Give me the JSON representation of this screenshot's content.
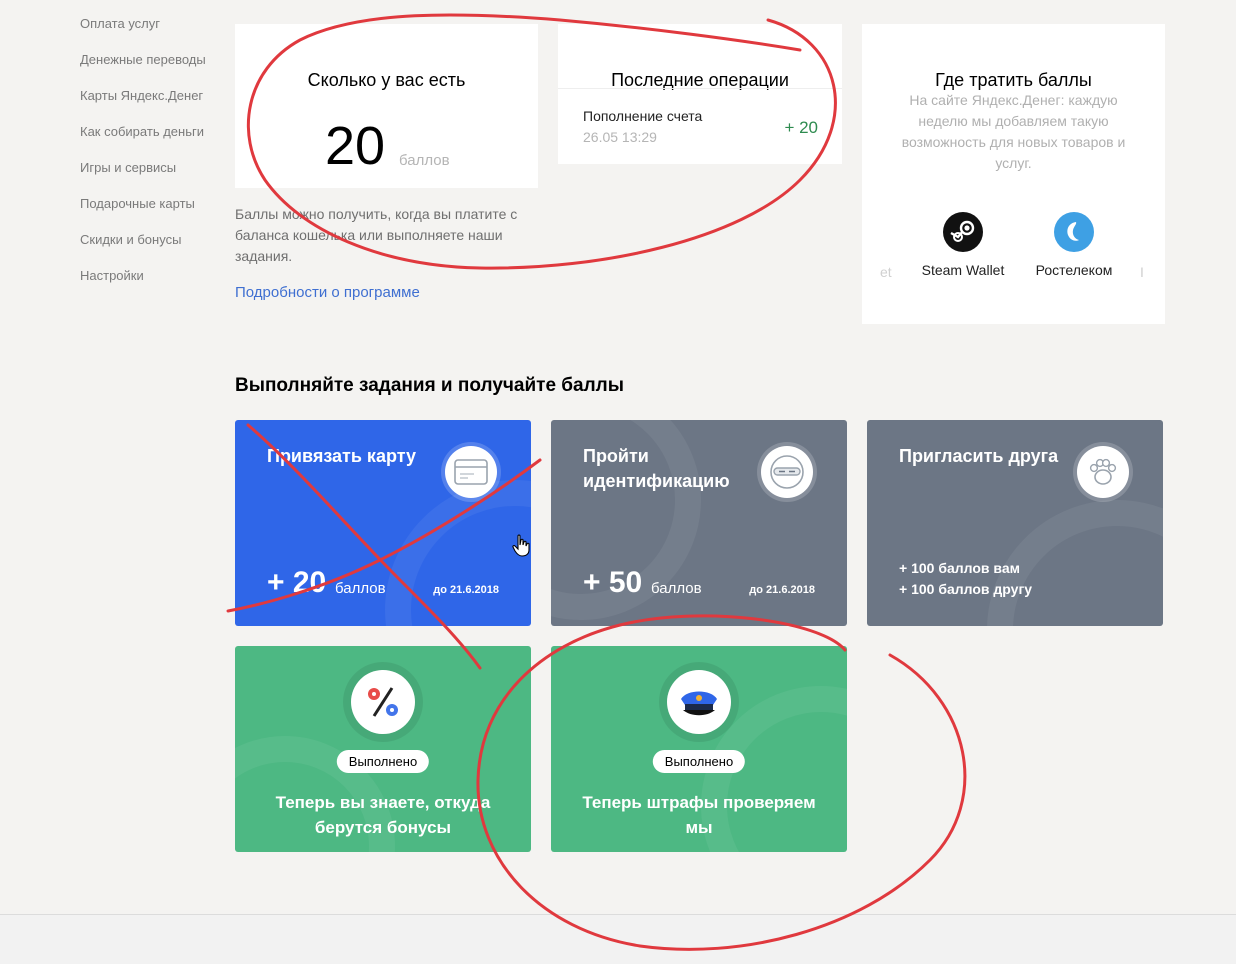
{
  "sidebar": {
    "items": [
      {
        "label": "Оплата услуг"
      },
      {
        "label": "Денежные переводы"
      },
      {
        "label": "Карты Яндекс.Денег"
      },
      {
        "label": "Как собирать деньги"
      },
      {
        "label": "Игры и сервисы"
      },
      {
        "label": "Подарочные карты"
      },
      {
        "label": "Скидки и бонусы"
      },
      {
        "label": "Настройки"
      }
    ]
  },
  "balance": {
    "title": "Сколько у вас есть",
    "value": "20",
    "unit": "баллов"
  },
  "operations": {
    "title": "Последние операции",
    "items": [
      {
        "name": "Пополнение счета",
        "date": "26.05 13:29",
        "amount": "+ 20"
      }
    ]
  },
  "spend": {
    "title": "Где тратить баллы",
    "description": "На сайте Яндекс.Денег: каждую неделю мы добавляем такую возможность для новых товаров и услуг.",
    "partners": [
      {
        "label": "Steam Wallet",
        "icon": "steam-icon"
      },
      {
        "label": "Ростелеком",
        "icon": "rostelecom-icon"
      }
    ],
    "partial_left": "et",
    "partial_right": "I"
  },
  "info": {
    "text": "Баллы можно получить, когда вы платите с баланса кошелька или выполняете наши задания.",
    "link": "Подробности о программе"
  },
  "tasks": {
    "heading": "Выполняйте задания и получайте баллы",
    "items": [
      {
        "title": "Привязать карту",
        "points": "+ 20",
        "unit": "баллов",
        "deadline": "до 21.6.2018",
        "icon": "card-icon"
      },
      {
        "title": "Пройти идентификацию",
        "points": "+ 50",
        "unit": "баллов",
        "deadline": "до 21.6.2018",
        "icon": "ninja-icon"
      },
      {
        "title": "Пригласить друга",
        "bonus1": "+ 100 баллов вам",
        "bonus2": "+ 100 баллов другу",
        "icon": "paw-icon"
      }
    ],
    "done": [
      {
        "badge": "Выполнено",
        "text": "Теперь вы знаете, откуда берутся бонусы",
        "icon": "percent-icon"
      },
      {
        "badge": "Выполнено",
        "text": "Теперь штрафы проверяем мы",
        "icon": "police-cap-icon"
      }
    ]
  },
  "colors": {
    "blue_tile": "#2f66e8",
    "gray_tile": "#6c7685",
    "green_tile": "#4db883",
    "link": "#3f6fd1",
    "positive": "#2e8b4f",
    "annotation": "#e0393e"
  }
}
